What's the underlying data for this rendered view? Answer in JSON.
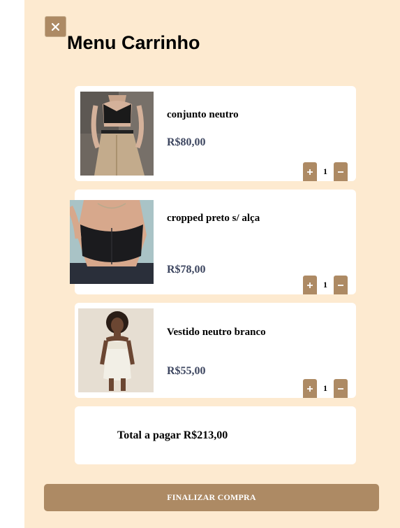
{
  "header": {
    "title": "Menu Carrinho",
    "close_icon": "close-icon"
  },
  "cart": {
    "items": [
      {
        "name": "conjunto neutro",
        "price": "R$80,00",
        "quantity": "1",
        "image": "photo of model in black crop top and beige trousers"
      },
      {
        "name": "cropped preto s/ alça",
        "price": "R$78,00",
        "quantity": "1",
        "image": "photo of model in black strapless corset top"
      },
      {
        "name": "Vestido neutro branco",
        "price": "R$55,00",
        "quantity": "1",
        "image": "photo of model in white mini dress"
      }
    ],
    "total_label": "Total a pagar R$213,00"
  },
  "checkout": {
    "label": "FINALIZAR COMPRA"
  },
  "colors": {
    "panel_background": "#fdead0",
    "accent": "#ad8a64",
    "card_background": "#ffffff",
    "price_text": "#3d4660"
  }
}
